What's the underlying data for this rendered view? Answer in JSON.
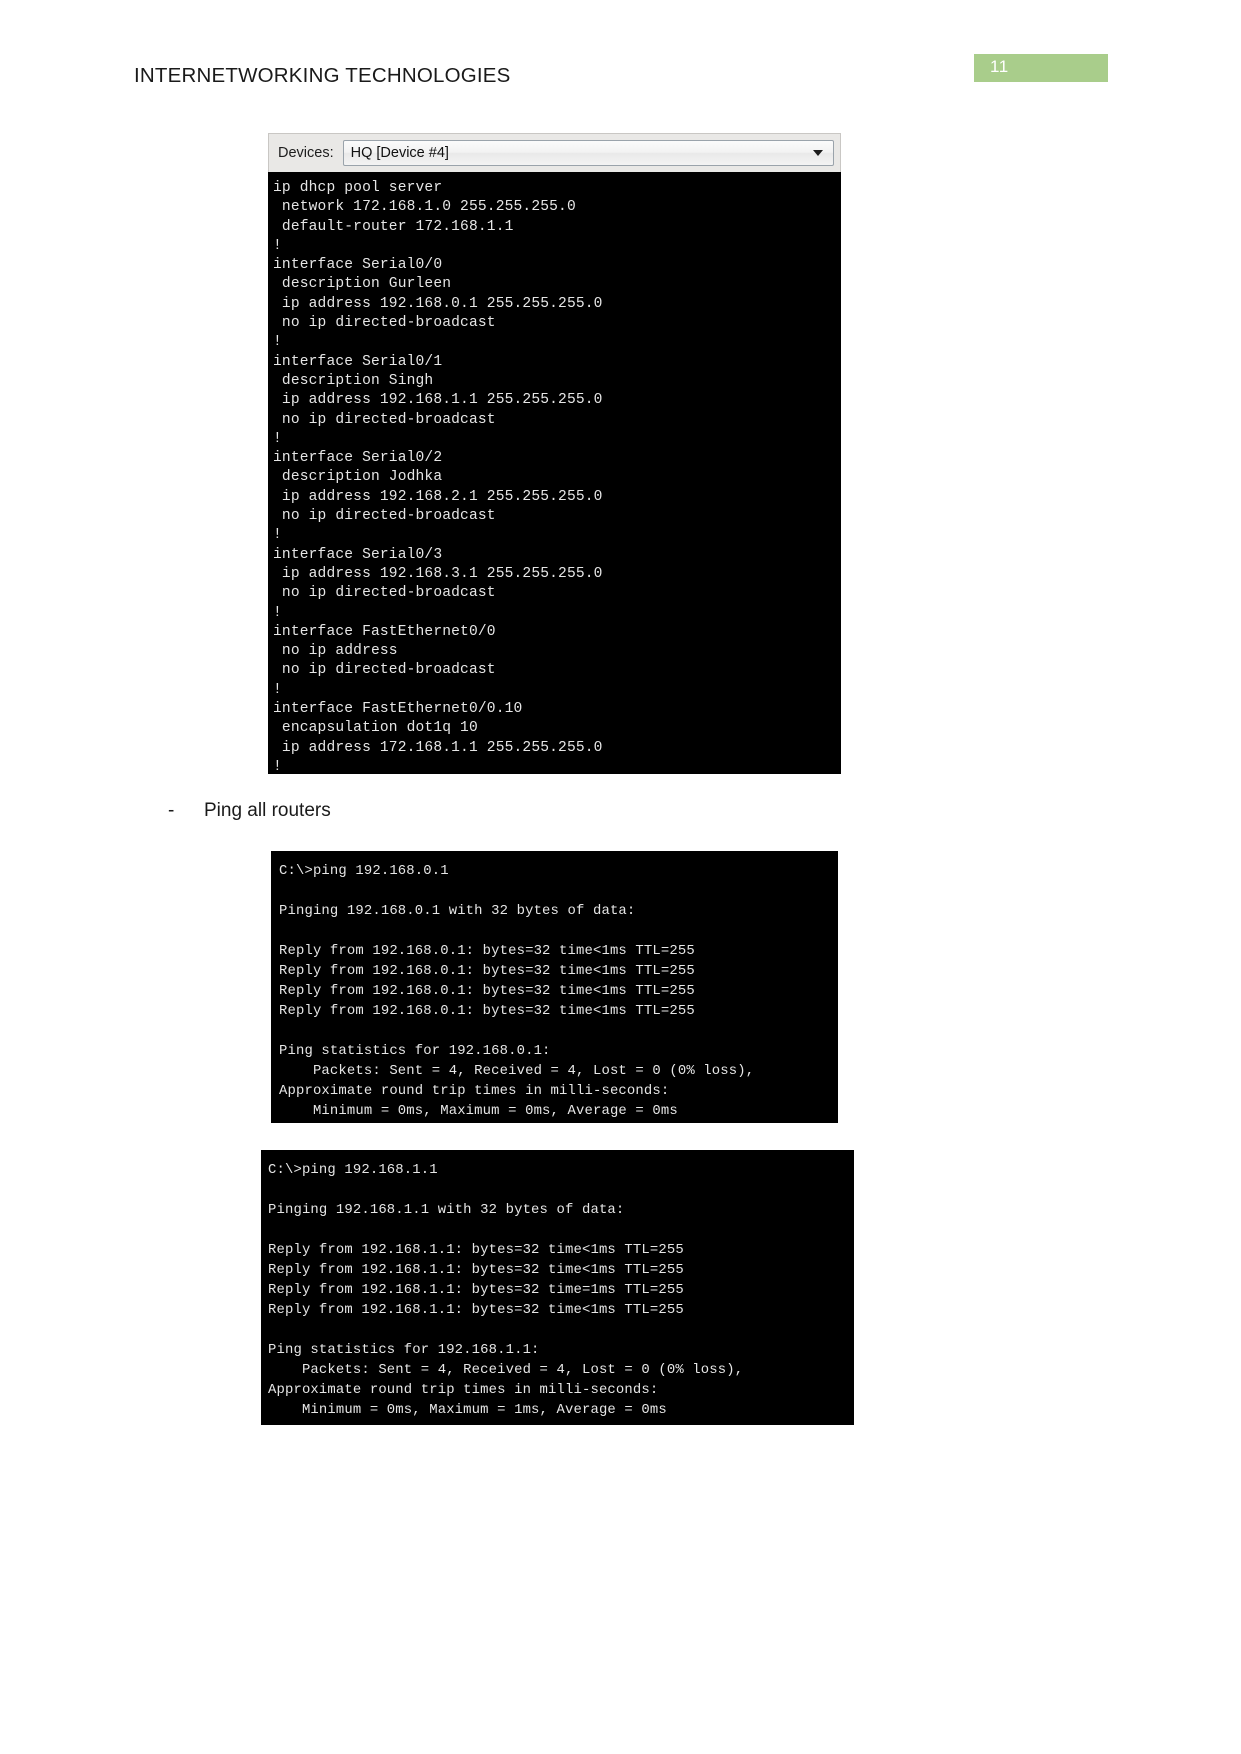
{
  "header": {
    "doc_title": "INTERNETWORKING TECHNOLOGIES",
    "page_number": "11",
    "badge_color": "#a9cd8b"
  },
  "config_screenshot": {
    "devices_label": "Devices:",
    "devices_selected": "HQ [Device #4]",
    "dropdown_icon": "chevron-down-icon",
    "terminal_lines": [
      "ip dhcp pool server",
      " network 172.168.1.0 255.255.255.0",
      " default-router 172.168.1.1",
      "!",
      "interface Serial0/0",
      " description Gurleen",
      " ip address 192.168.0.1 255.255.255.0",
      " no ip directed-broadcast",
      "!",
      "interface Serial0/1",
      " description Singh",
      " ip address 192.168.1.1 255.255.255.0",
      " no ip directed-broadcast",
      "!",
      "interface Serial0/2",
      " description Jodhka",
      " ip address 192.168.2.1 255.255.255.0",
      " no ip directed-broadcast",
      "!",
      "interface Serial0/3",
      " ip address 192.168.3.1 255.255.255.0",
      " no ip directed-broadcast",
      "!",
      "interface FastEthernet0/0",
      " no ip address",
      " no ip directed-broadcast",
      "!",
      "interface FastEthernet0/0.10",
      " encapsulation dot1q 10",
      " ip address 172.168.1.1 255.255.255.0",
      "!"
    ]
  },
  "bullet": {
    "marker": "-",
    "text": "Ping all routers"
  },
  "ping_screenshot_1": {
    "terminal_lines": [
      "C:\\>ping 192.168.0.1",
      "",
      "Pinging 192.168.0.1 with 32 bytes of data:",
      "",
      "Reply from 192.168.0.1: bytes=32 time<1ms TTL=255",
      "Reply from 192.168.0.1: bytes=32 time<1ms TTL=255",
      "Reply from 192.168.0.1: bytes=32 time<1ms TTL=255",
      "Reply from 192.168.0.1: bytes=32 time<1ms TTL=255",
      "",
      "Ping statistics for 192.168.0.1:",
      "    Packets: Sent = 4, Received = 4, Lost = 0 (0% loss),",
      "Approximate round trip times in milli-seconds:",
      "    Minimum = 0ms, Maximum = 0ms, Average = 0ms"
    ]
  },
  "ping_screenshot_2": {
    "terminal_lines": [
      "C:\\>ping 192.168.1.1",
      "",
      "Pinging 192.168.1.1 with 32 bytes of data:",
      "",
      "Reply from 192.168.1.1: bytes=32 time<1ms TTL=255",
      "Reply from 192.168.1.1: bytes=32 time<1ms TTL=255",
      "Reply from 192.168.1.1: bytes=32 time=1ms TTL=255",
      "Reply from 192.168.1.1: bytes=32 time<1ms TTL=255",
      "",
      "Ping statistics for 192.168.1.1:",
      "    Packets: Sent = 4, Received = 4, Lost = 0 (0% loss),",
      "Approximate round trip times in milli-seconds:",
      "    Minimum = 0ms, Maximum = 1ms, Average = 0ms"
    ]
  }
}
